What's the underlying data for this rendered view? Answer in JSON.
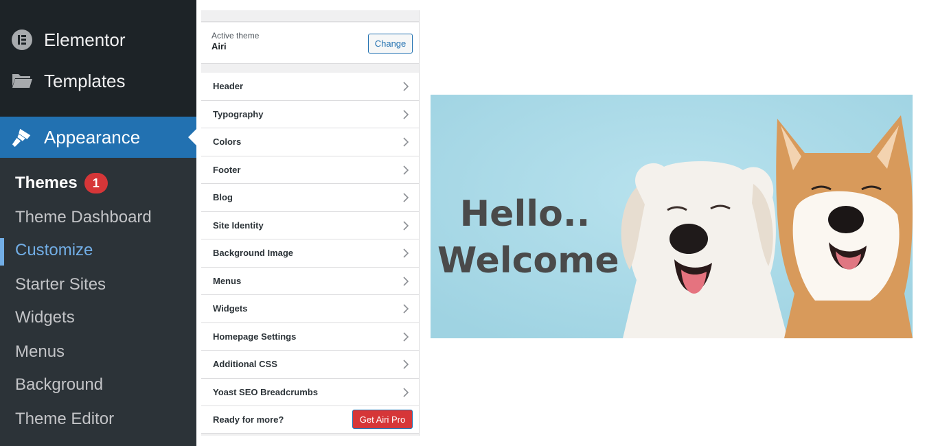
{
  "sidebar": {
    "top_items": [
      {
        "label": "Elementor",
        "icon": "elementor-icon"
      },
      {
        "label": "Templates",
        "icon": "folder-icon"
      }
    ],
    "active": {
      "label": "Appearance",
      "icon": "paintbrush-icon"
    },
    "submenu": [
      {
        "label": "Themes",
        "badge": "1"
      },
      {
        "label": "Theme Dashboard"
      },
      {
        "label": "Customize"
      },
      {
        "label": "Starter Sites"
      },
      {
        "label": "Widgets"
      },
      {
        "label": "Menus"
      },
      {
        "label": "Background"
      },
      {
        "label": "Theme Editor"
      }
    ]
  },
  "customizer": {
    "active_theme_label": "Active theme",
    "active_theme_name": "Airi",
    "change_label": "Change",
    "sections": [
      "Header",
      "Typography",
      "Colors",
      "Footer",
      "Blog",
      "Site Identity",
      "Background Image",
      "Menus",
      "Widgets",
      "Homepage Settings",
      "Additional CSS",
      "Yoast SEO Breadcrumbs"
    ],
    "pro_prompt": "Ready for more?",
    "pro_button": "Get Airi Pro"
  },
  "preview": {
    "line1": "Hello..",
    "line2": "Welcome",
    "background_color": "#a7d8e6"
  },
  "colors": {
    "sidebar_bg": "#1d2327",
    "submenu_bg": "#2c3338",
    "accent": "#2271b1",
    "current_link": "#72aee6",
    "badge": "#d63638"
  }
}
